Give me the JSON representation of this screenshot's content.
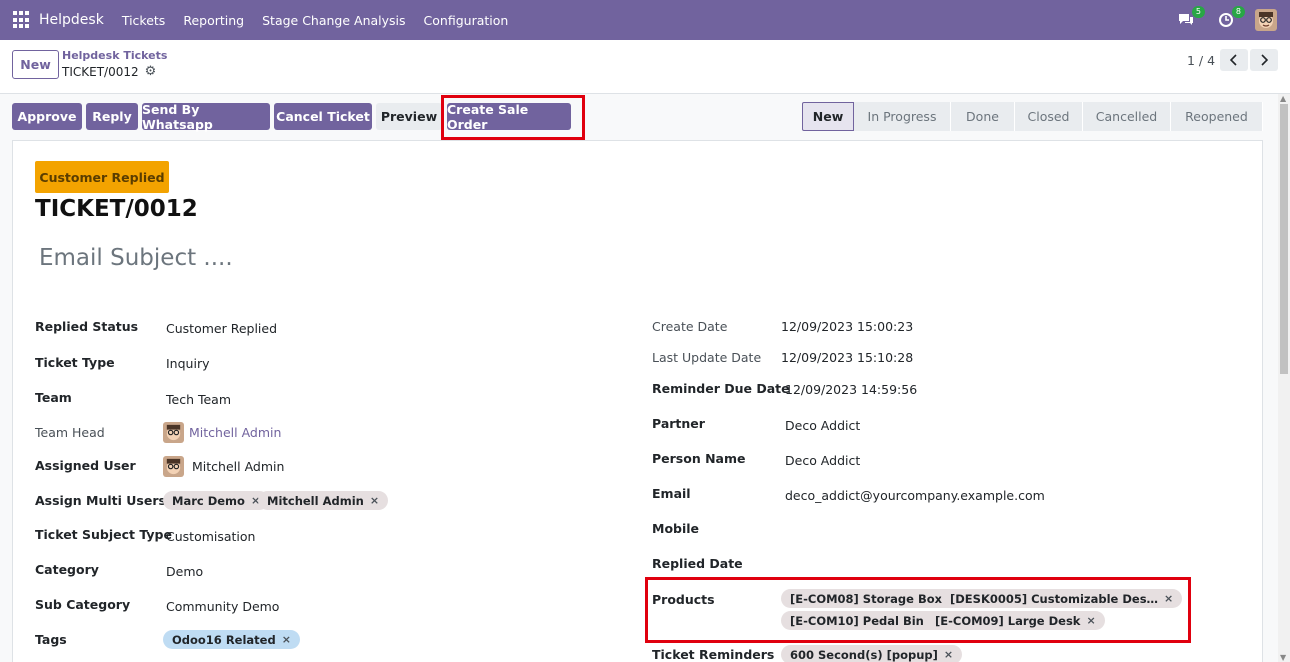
{
  "navbar": {
    "brand": "Helpdesk",
    "menu": [
      "Tickets",
      "Reporting",
      "Stage Change Analysis",
      "Configuration"
    ],
    "chat_count": "5",
    "activity_count": "8"
  },
  "control_panel": {
    "new_label": "New",
    "breadcrumb_parent": "Helpdesk Tickets",
    "breadcrumb_current": "TICKET/0012",
    "pager": "1 / 4"
  },
  "actions": {
    "approve": "Approve",
    "reply": "Reply",
    "send_whatsapp": "Send By Whatsapp",
    "cancel_ticket": "Cancel Ticket",
    "preview": "Preview",
    "create_sale_order": "Create Sale Order"
  },
  "stages": [
    "New",
    "In Progress",
    "Done",
    "Closed",
    "Cancelled",
    "Reopened"
  ],
  "form": {
    "ribbon": "Customer Replied",
    "ticket_number": "TICKET/0012",
    "email_subject_placeholder": "Email Subject ....",
    "left": {
      "replied_status_label": "Replied Status",
      "replied_status_value": "Customer Replied",
      "ticket_type_label": "Ticket Type",
      "ticket_type_value": "Inquiry",
      "team_label": "Team",
      "team_value": "Tech Team",
      "team_head_label": "Team Head",
      "team_head_value": "Mitchell Admin",
      "assigned_user_label": "Assigned User",
      "assigned_user_value": "Mitchell Admin",
      "assign_multi_label": "Assign Multi Users",
      "assign_multi_tags": [
        "Marc Demo",
        "Mitchell Admin"
      ],
      "subject_type_label": "Ticket Subject Type",
      "subject_type_value": "Customisation",
      "category_label": "Category",
      "category_value": "Demo",
      "sub_category_label": "Sub Category",
      "sub_category_value": "Community Demo",
      "tags_label": "Tags",
      "tags": [
        "Odoo16 Related"
      ]
    },
    "right": {
      "create_date_label": "Create Date",
      "create_date_value": "12/09/2023 15:00:23",
      "last_update_label": "Last Update Date",
      "last_update_value": "12/09/2023 15:10:28",
      "reminder_due_label": "Reminder Due Date",
      "reminder_due_value": "12/09/2023 14:59:56",
      "partner_label": "Partner",
      "partner_value": "Deco Addict",
      "person_name_label": "Person Name",
      "person_name_value": "Deco Addict",
      "email_label": "Email",
      "email_value": "deco_addict@yourcompany.example.com",
      "mobile_label": "Mobile",
      "replied_date_label": "Replied Date",
      "products_label": "Products",
      "products": [
        "[E-COM08] Storage Box",
        "[DESK0005] Customizable Des…",
        "[E-COM10] Pedal Bin",
        "[E-COM09] Large Desk"
      ],
      "reminders_label": "Ticket Reminders",
      "reminders": [
        "600 Second(s) [popup]"
      ]
    }
  },
  "colors": {
    "brand": "#71639e",
    "ribbon": "#f3a300",
    "highlight": "#e0000e"
  }
}
